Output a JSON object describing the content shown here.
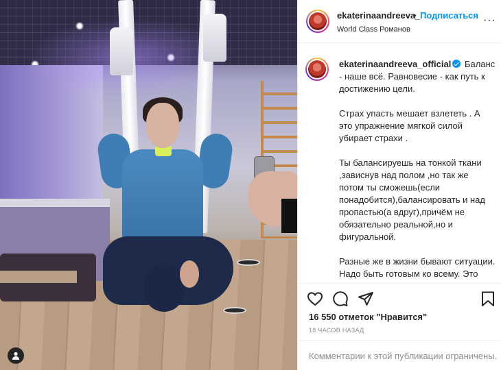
{
  "post": {
    "username": "ekaterinaandreeva_",
    "separator": "•",
    "follow_label": "Подписаться",
    "location": "World Class Романов",
    "more_label": "···"
  },
  "caption": {
    "username": "ekaterinaandreeva_official",
    "verified": true,
    "paragraphs": [
      "Баланс - наше всё. Равновесие - как путь к достижению цели.",
      "Страх упасть мешает взлететь . А это упражнение мягкой силой убирает страхи .",
      "Ты балансируешь на тонкой ткани ,зависнув над полом ,но так же потом ты сможешь(если понадобится),балансировать и над пропастью(а вдруг),причём не обязательно реальной,но и фигуральной.",
      "Разные же в жизни бывают ситуации. Надо быть готовым ко всему. Это принцип древнего иранского боевого искусства Зур-Хане"
    ]
  },
  "actions": {
    "like_icon": "heart-icon",
    "comment_icon": "comment-icon",
    "share_icon": "share-icon",
    "save_icon": "bookmark-icon"
  },
  "stats": {
    "likes_text": "16 550 отметок \"Нравится\"",
    "time_text": "18 часов назад"
  },
  "comments": {
    "disabled_text": "Комментарии к этой публикации ограничены."
  },
  "photo": {
    "tag_icon": "user-tag-icon"
  },
  "colors": {
    "accent": "#0095f6",
    "text": "#262626",
    "muted": "#8e8e8e",
    "border": "#efefef"
  }
}
